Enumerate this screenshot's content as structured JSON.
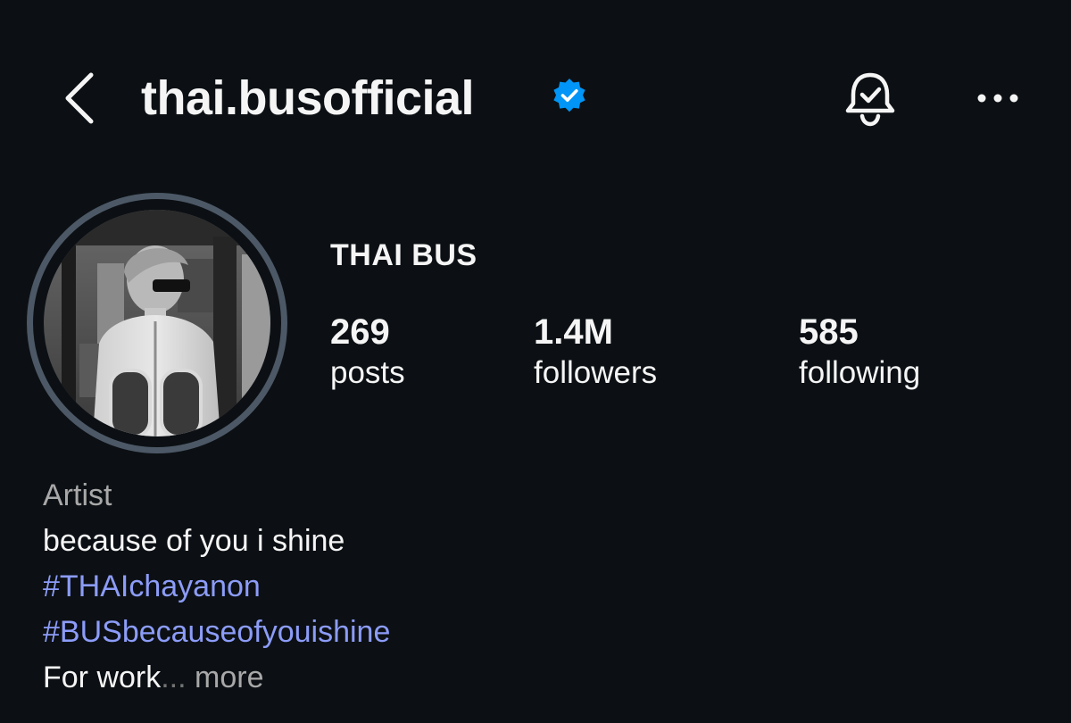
{
  "header": {
    "username": "thai.busofficial",
    "back_icon": "chevron-left-icon",
    "verified_icon": "verified-badge-icon",
    "bell_icon": "notification-bell-check-icon",
    "more_icon": "more-horizontal-icon"
  },
  "profile": {
    "display_name": "THAI BUS",
    "stats": [
      {
        "value": "269",
        "label": "posts"
      },
      {
        "value": "1.4M",
        "label": "followers"
      },
      {
        "value": "585",
        "label": "following"
      }
    ]
  },
  "bio": {
    "category": "Artist",
    "line1": "because of you i shine",
    "hashtag1": "#THAIchayanon",
    "hashtag2": "#BUSbecauseofyouishine",
    "line4": "For work",
    "ellipsis": "...",
    "more_label": " more"
  },
  "colors": {
    "background": "#0c1014",
    "text": "#f5f5f5",
    "secondary": "#a8a8a8",
    "hashtag": "#8c9cf8",
    "verified": "#0095f6",
    "avatar_ring": "#4c5866"
  }
}
